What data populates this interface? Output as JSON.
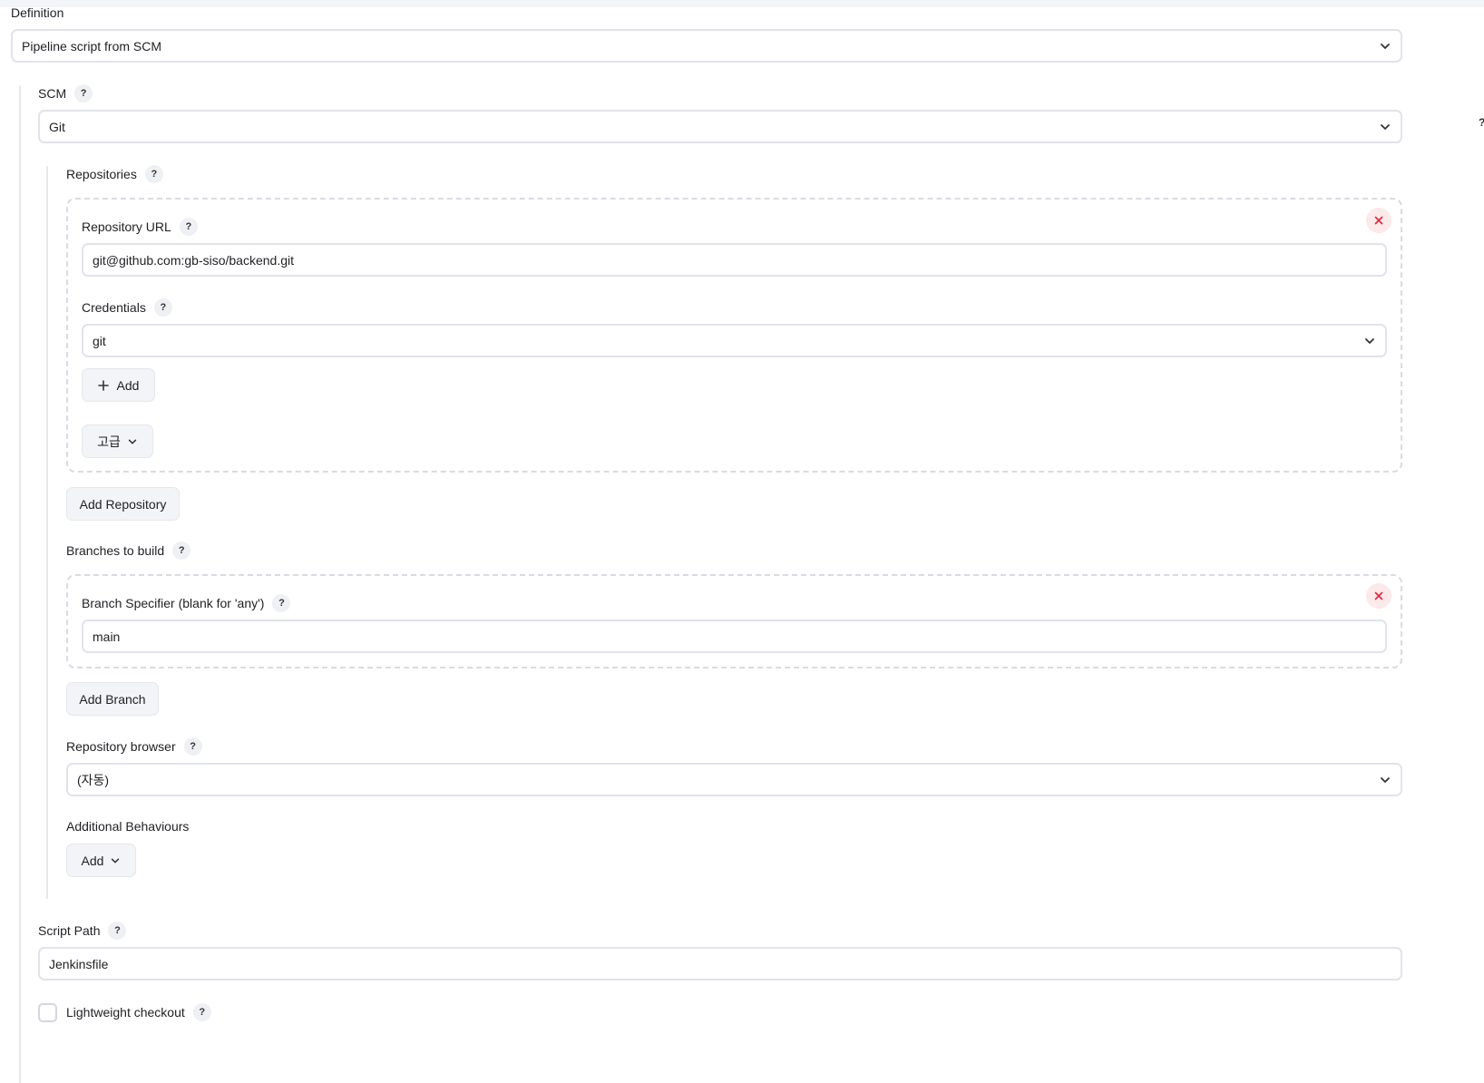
{
  "definition": {
    "label": "Definition",
    "value": "Pipeline script from SCM"
  },
  "scm": {
    "label": "SCM",
    "value": "Git"
  },
  "repositories": {
    "label": "Repositories",
    "url_label": "Repository URL",
    "url_value": "git@github.com:gb-siso/backend.git",
    "credentials_label": "Credentials",
    "credentials_value": "git",
    "add_credentials_label": "Add",
    "advanced_label": "고급",
    "add_repository_label": "Add Repository"
  },
  "branches": {
    "label": "Branches to build",
    "specifier_label": "Branch Specifier (blank for 'any')",
    "specifier_value": "main",
    "add_branch_label": "Add Branch"
  },
  "repository_browser": {
    "label": "Repository browser",
    "value": "(자동)"
  },
  "additional_behaviours": {
    "label": "Additional Behaviours",
    "add_label": "Add"
  },
  "script_path": {
    "label": "Script Path",
    "value": "Jenkinsfile"
  },
  "lightweight_checkout": {
    "label": "Lightweight checkout",
    "checked": false
  },
  "help_glyph": "?",
  "colors": {
    "border": "#e1e3ea",
    "button_bg": "#f3f4f7",
    "remove_bg": "#fde8ea",
    "remove_x": "#e0263a"
  }
}
